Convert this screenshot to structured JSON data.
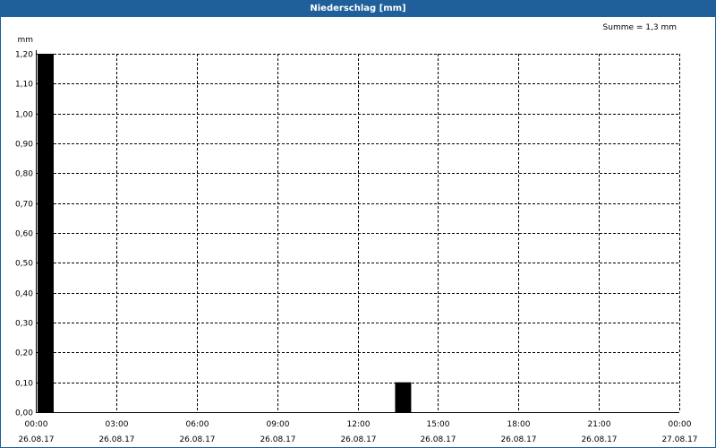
{
  "window": {
    "title": "Niederschlag [mm]"
  },
  "summary": {
    "label": "Summe = 1,3 mm"
  },
  "chart_data": {
    "type": "bar",
    "title": "Niederschlag [mm]",
    "ylabel": "mm",
    "xlabel": "",
    "ylim": [
      0,
      1.2
    ],
    "xlim_hours": [
      0,
      24
    ],
    "y_ticks": [
      "0,00",
      "0,10",
      "0,20",
      "0,30",
      "0,40",
      "0,50",
      "0,60",
      "0,70",
      "0,80",
      "0,90",
      "1,00",
      "1,10",
      "1,20"
    ],
    "x_ticks": [
      {
        "time": "00:00",
        "date": "26.08.17"
      },
      {
        "time": "03:00",
        "date": "26.08.17"
      },
      {
        "time": "06:00",
        "date": "26.08.17"
      },
      {
        "time": "09:00",
        "date": "26.08.17"
      },
      {
        "time": "12:00",
        "date": "26.08.17"
      },
      {
        "time": "15:00",
        "date": "26.08.17"
      },
      {
        "time": "18:00",
        "date": "26.08.17"
      },
      {
        "time": "21:00",
        "date": "26.08.17"
      },
      {
        "time": "00:00",
        "date": "27.08.17"
      }
    ],
    "bar_interval_minutes": 40,
    "bars": [
      {
        "start": "26.08.17 00:00",
        "end": "26.08.17 00:40",
        "value": 1.2
      },
      {
        "start": "26.08.17 13:20",
        "end": "26.08.17 14:00",
        "value": 0.1
      }
    ],
    "grid": true,
    "colors": {
      "bar": "#000000",
      "title_bar": "#1f5f9a",
      "grid": "#000000"
    }
  }
}
